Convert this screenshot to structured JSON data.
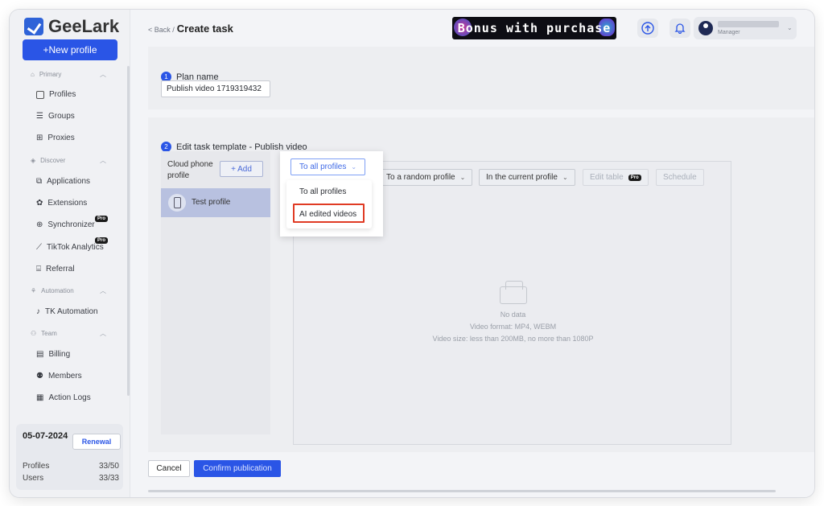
{
  "brand": {
    "name": "GeeLark"
  },
  "sidebar": {
    "new_profile": "+New profile",
    "sections": [
      {
        "label": "Primary",
        "items": [
          "Profiles",
          "Groups",
          "Proxies"
        ]
      },
      {
        "label": "Discover",
        "items": [
          "Applications",
          "Extensions",
          "Synchronizer",
          "TikTok Analytics",
          "Referral"
        ]
      },
      {
        "label": "Automation",
        "items": [
          "TK Automation"
        ]
      },
      {
        "label": "Team",
        "items": [
          "Billing",
          "Members",
          "Action Logs"
        ]
      }
    ],
    "pro_badge": "Pro",
    "usage": {
      "date": "05-07-2024",
      "renewal": "Renewal",
      "profiles_label": "Profiles",
      "profiles_value": "33/50",
      "users_label": "Users",
      "users_value": "33/33"
    }
  },
  "header": {
    "back": "< Back /",
    "title": "Create task",
    "bonus": "Bonus with purchase",
    "user_role": "Manager"
  },
  "plan": {
    "step_num": "1",
    "label": "Plan name",
    "value": "Publish video 1719319432"
  },
  "template": {
    "step_num": "2",
    "label": "Edit task template - Publish video",
    "cloud_label": "Cloud phone profile",
    "add": "+ Add",
    "profile": "Test profile",
    "toolbar": {
      "all_profiles": "To all profiles",
      "random_profile": "To a random profile",
      "current_profile": "In the current profile",
      "edit_table": "Edit table",
      "schedule": "Schedule"
    },
    "dropdown": {
      "options": [
        "To all profiles",
        "AI edited videos"
      ]
    },
    "empty": {
      "title": "No data",
      "format": "Video format: MP4, WEBM",
      "size": "Video size: less than 200MB, no more than 1080P"
    }
  },
  "footer": {
    "cancel": "Cancel",
    "confirm": "Confirm publication"
  },
  "colors": {
    "accent": "#2a55e6",
    "highlight": "#e03b24"
  }
}
